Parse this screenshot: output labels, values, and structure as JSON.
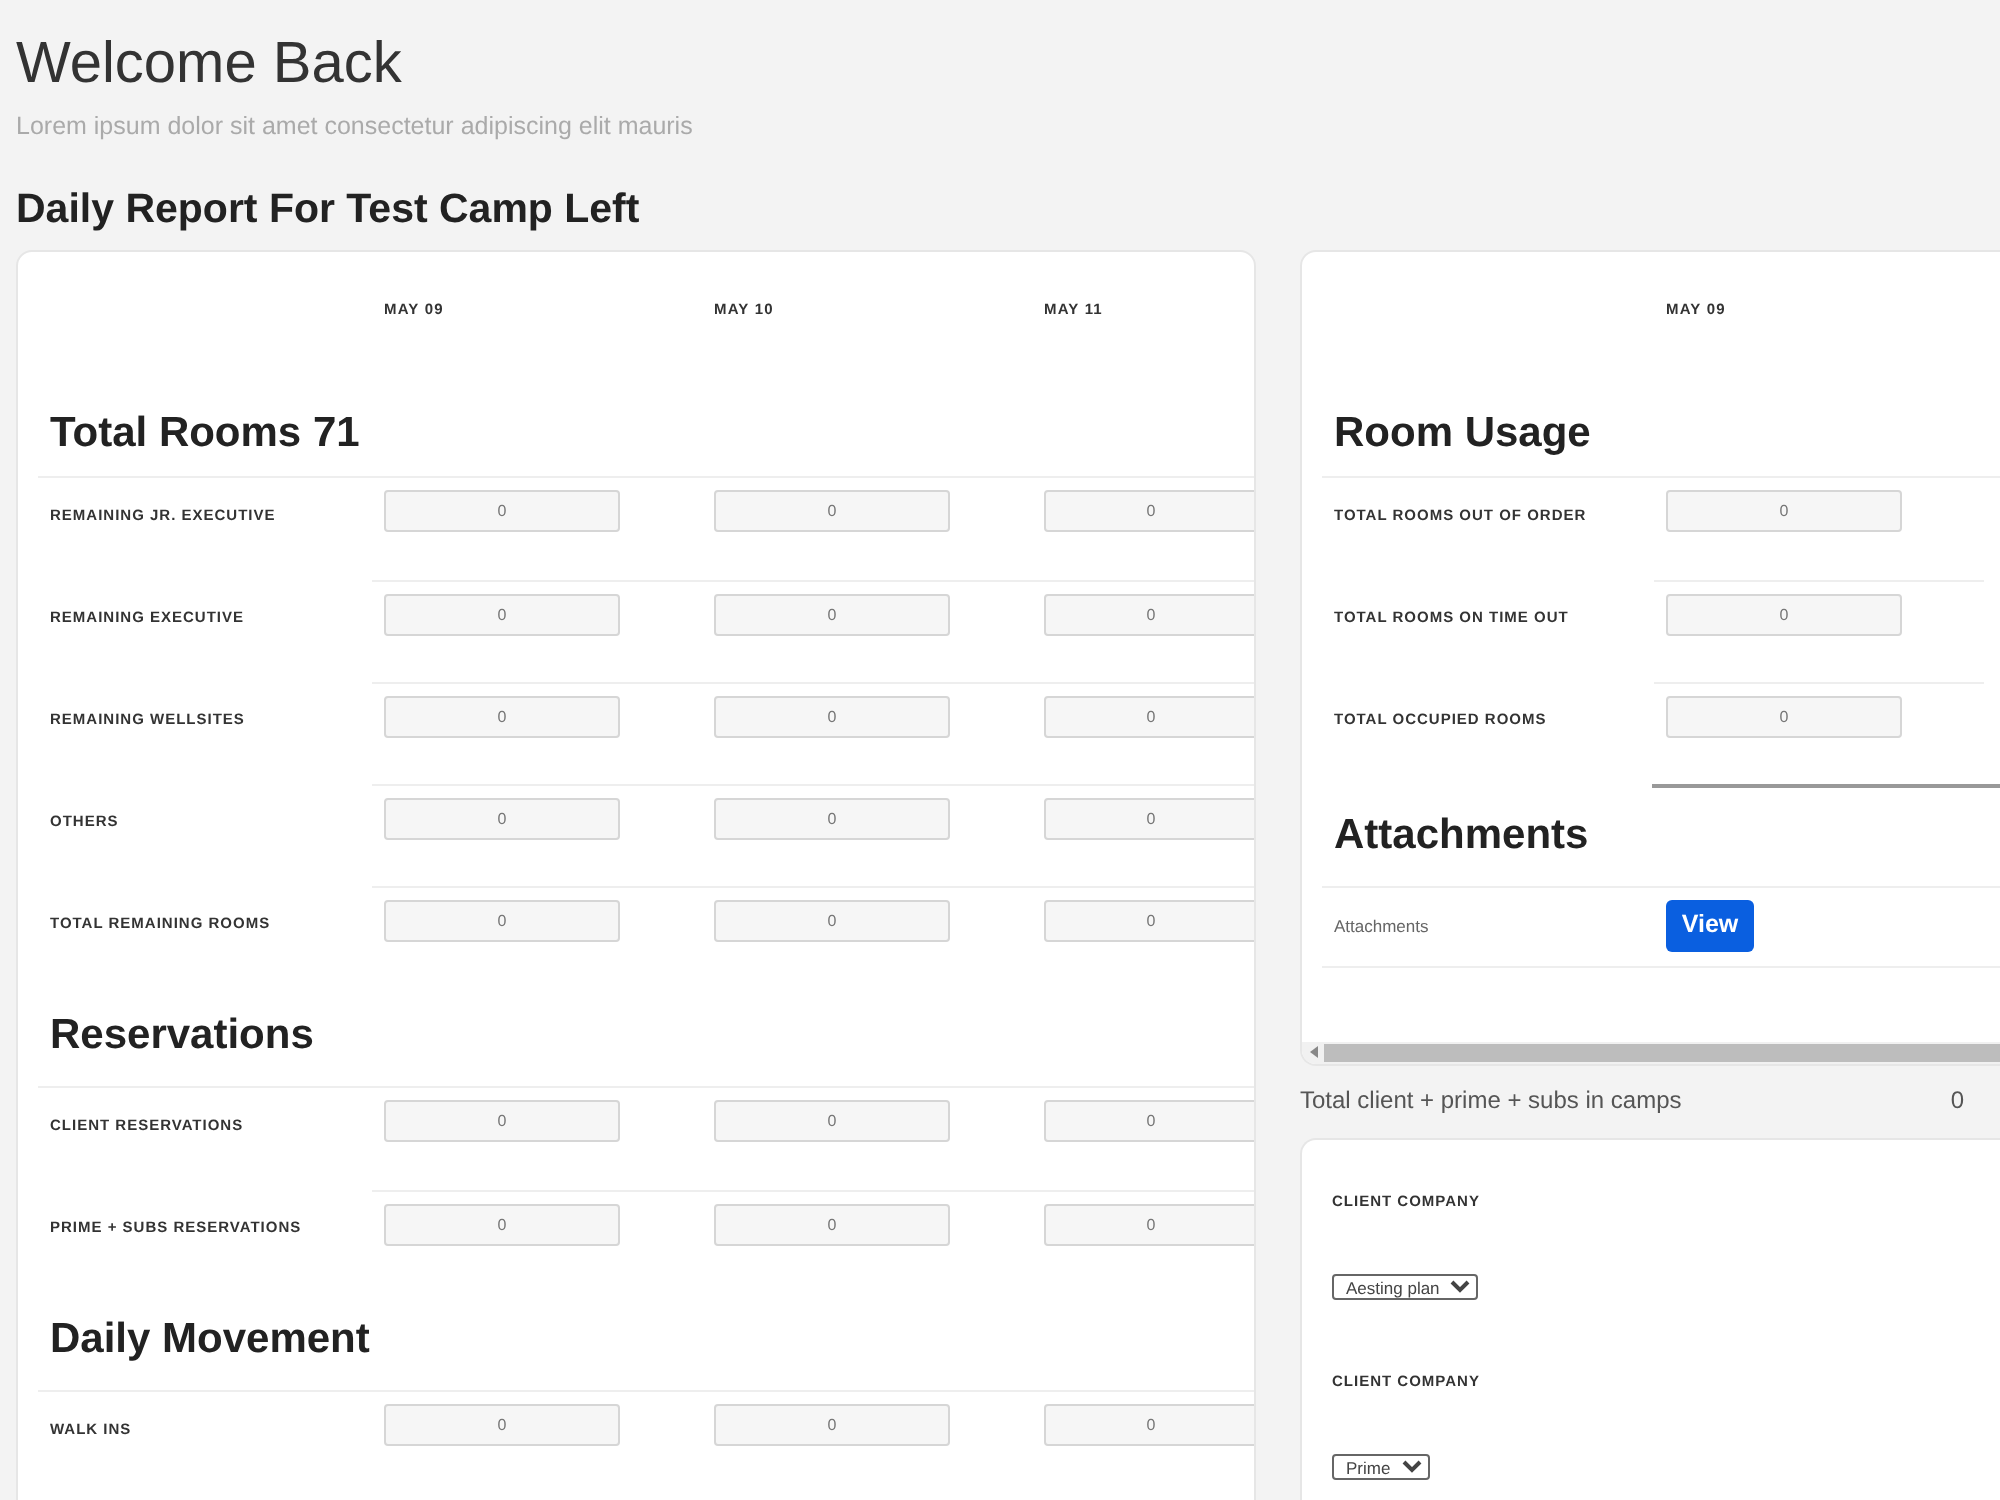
{
  "header": {
    "title": "Welcome Back",
    "subtitle": "Lorem ipsum dolor sit amet consectetur adipiscing elit mauris"
  },
  "report_title": "Daily Report For Test Camp Left",
  "main_table": {
    "columns": [
      "MAY 09",
      "MAY 10",
      "MAY 11"
    ],
    "sections": [
      {
        "title": "Total Rooms 71",
        "rows": [
          {
            "kind": "input",
            "label": "REMAINING JR. EXECUTIVE",
            "values": [
              "0",
              "0",
              "0"
            ]
          },
          {
            "kind": "input",
            "label": "REMAINING EXECUTIVE",
            "values": [
              "0",
              "0",
              "0"
            ]
          },
          {
            "kind": "input",
            "label": "REMAINING WELLSITES",
            "values": [
              "0",
              "0",
              "0"
            ]
          },
          {
            "kind": "input",
            "label": "OTHERS",
            "values": [
              "0",
              "0",
              "0"
            ]
          },
          {
            "kind": "input",
            "label": "TOTAL REMAINING ROOMS",
            "values": [
              "0",
              "0",
              "0"
            ]
          }
        ]
      },
      {
        "title": "Reservations",
        "rows": [
          {
            "kind": "input",
            "label": "CLIENT RESERVATIONS",
            "values": [
              "0",
              "0",
              "0"
            ]
          },
          {
            "kind": "input",
            "label": "PRIME + SUBS RESERVATIONS",
            "values": [
              "0",
              "0",
              "0"
            ]
          }
        ]
      },
      {
        "title": "Daily Movement",
        "rows": [
          {
            "kind": "input",
            "label": "WALK INS",
            "values": [
              "0",
              "0",
              "0"
            ]
          }
        ]
      }
    ]
  },
  "side_table": {
    "columns": [
      "MAY 09"
    ],
    "sections": [
      {
        "title": "Room Usage",
        "rows": [
          {
            "kind": "input",
            "label": "TOTAL ROOMS OUT OF ORDER",
            "values": [
              "0"
            ]
          },
          {
            "kind": "input",
            "label": "TOTAL ROOMS ON TIME OUT",
            "values": [
              "0"
            ]
          },
          {
            "kind": "input",
            "label": "TOTAL OCCUPIED ROOMS",
            "values": [
              "0"
            ]
          }
        ]
      },
      {
        "title": "Attachments",
        "rows": [
          {
            "kind": "button",
            "label": "Attachments",
            "values": [
              "View"
            ]
          }
        ]
      }
    ]
  },
  "total_line": {
    "label": "Total client + prime + subs in camps",
    "value": "0"
  },
  "company_card": {
    "fields": [
      {
        "label": "CLIENT COMPANY",
        "value": "Aesting plan"
      },
      {
        "label": "CLIENT COMPANY",
        "value": "Prime"
      }
    ]
  }
}
